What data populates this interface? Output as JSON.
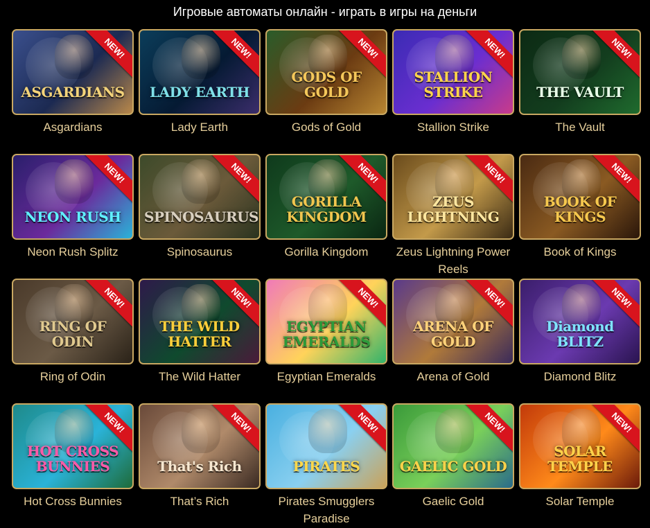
{
  "page": {
    "title": "Игровые автоматы онлайн - играть в игры на деньги",
    "badge_label": "NEW!"
  },
  "games": [
    {
      "name": "Asgardians",
      "art": "ASGARDIANS",
      "bg": [
        "#3a4f8c",
        "#1c2a52",
        "#b9884a"
      ],
      "text_color": "#f3d37a"
    },
    {
      "name": "Lady Earth",
      "art": "LADY EARTH",
      "bg": [
        "#0b3d5a",
        "#051a33",
        "#3b2d6b"
      ],
      "text_color": "#7fe0e8"
    },
    {
      "name": "Gods of Gold",
      "art": "GODS OF GOLD",
      "bg": [
        "#2a5c2a",
        "#6b3b12",
        "#b88632"
      ],
      "text_color": "#f4c75a"
    },
    {
      "name": "Stallion Strike",
      "art": "STALLION STRIKE",
      "bg": [
        "#3b2bb4",
        "#6a2ed0",
        "#c93b8a"
      ],
      "text_color": "#ffd54a"
    },
    {
      "name": "The Vault",
      "art": "THE VAULT",
      "bg": [
        "#0c2a14",
        "#133d1e",
        "#1f6b2e"
      ],
      "text_color": "#e9ffe9"
    },
    {
      "name": "Neon Rush Splitz",
      "art": "NEON RUSH",
      "bg": [
        "#2a1f6b",
        "#6b2a9c",
        "#2ab3d8"
      ],
      "text_color": "#5ff0ff"
    },
    {
      "name": "Spinosaurus",
      "art": "SPINOSAURUS",
      "bg": [
        "#3d4a2a",
        "#6b5a3a",
        "#2a331f"
      ],
      "text_color": "#d9d0c0"
    },
    {
      "name": "Gorilla Kingdom",
      "art": "GORILLA KINGDOM",
      "bg": [
        "#0f3a1c",
        "#1e5a2a",
        "#0a2612"
      ],
      "text_color": "#f1c64f"
    },
    {
      "name": "Zeus Lightning Power Reels",
      "art": "ZEUS LIGHTNING",
      "bg": [
        "#6a4b1c",
        "#c39a4a",
        "#3a2a14"
      ],
      "text_color": "#ffe7a0"
    },
    {
      "name": "Book of Kings",
      "art": "BOOK OF KINGS",
      "bg": [
        "#4a2a12",
        "#8a5a22",
        "#2a160a"
      ],
      "text_color": "#f6c84e"
    },
    {
      "name": "Ring of Odin",
      "art": "RING OF ODIN",
      "bg": [
        "#4a3a2a",
        "#6b5a46",
        "#2a2218"
      ],
      "text_color": "#e0c98f"
    },
    {
      "name": "The Wild Hatter",
      "art": "THE WILD HATTER",
      "bg": [
        "#2e1a4a",
        "#0f4a2e",
        "#4a1a3a"
      ],
      "text_color": "#ffcf3a"
    },
    {
      "name": "Egyptian Emeralds",
      "art": "EGYPTIAN EMERALDS",
      "bg": [
        "#f07ab8",
        "#ffd35a",
        "#32b36a"
      ],
      "text_color": "#2c9a3a"
    },
    {
      "name": "Arena of Gold",
      "art": "ARENA OF GOLD",
      "bg": [
        "#5a3a8a",
        "#b07a3a",
        "#3a2a5a"
      ],
      "text_color": "#ffd27a"
    },
    {
      "name": "Diamond Blitz",
      "art": "Diamond BLITZ",
      "bg": [
        "#3b1e6b",
        "#6b3ab0",
        "#2a1450"
      ],
      "text_color": "#7fe3ff"
    },
    {
      "name": "Hot Cross Bunnies",
      "art": "HOT CROSS BUNNIES",
      "bg": [
        "#1e8a8a",
        "#2ab3d8",
        "#1e6b3a"
      ],
      "text_color": "#ff5aa8"
    },
    {
      "name": "That’s Rich",
      "art": "That's Rich",
      "bg": [
        "#6a4a3a",
        "#b08a6a",
        "#3a2a22"
      ],
      "text_color": "#f6e7d0"
    },
    {
      "name": "Pirates Smugglers Paradise",
      "art": "PIRATES",
      "bg": [
        "#4ab0e0",
        "#8ad0f0",
        "#c9a25a"
      ],
      "text_color": "#ffd84a"
    },
    {
      "name": "Gaelic Gold",
      "art": "GAELIC GOLD",
      "bg": [
        "#3a9a3a",
        "#7ad05a",
        "#2a6b8a"
      ],
      "text_color": "#ffd24a"
    },
    {
      "name": "Solar Temple",
      "art": "SOLAR TEMPLE",
      "bg": [
        "#c23a0a",
        "#ff8a1a",
        "#6b1a0a"
      ],
      "text_color": "#ffd24a"
    }
  ],
  "colors": {
    "background": "#000000",
    "title_text": "#ffffff",
    "caption_text": "#e6cf9b",
    "tile_border": "#c9a862",
    "badge": "#d8141d"
  }
}
